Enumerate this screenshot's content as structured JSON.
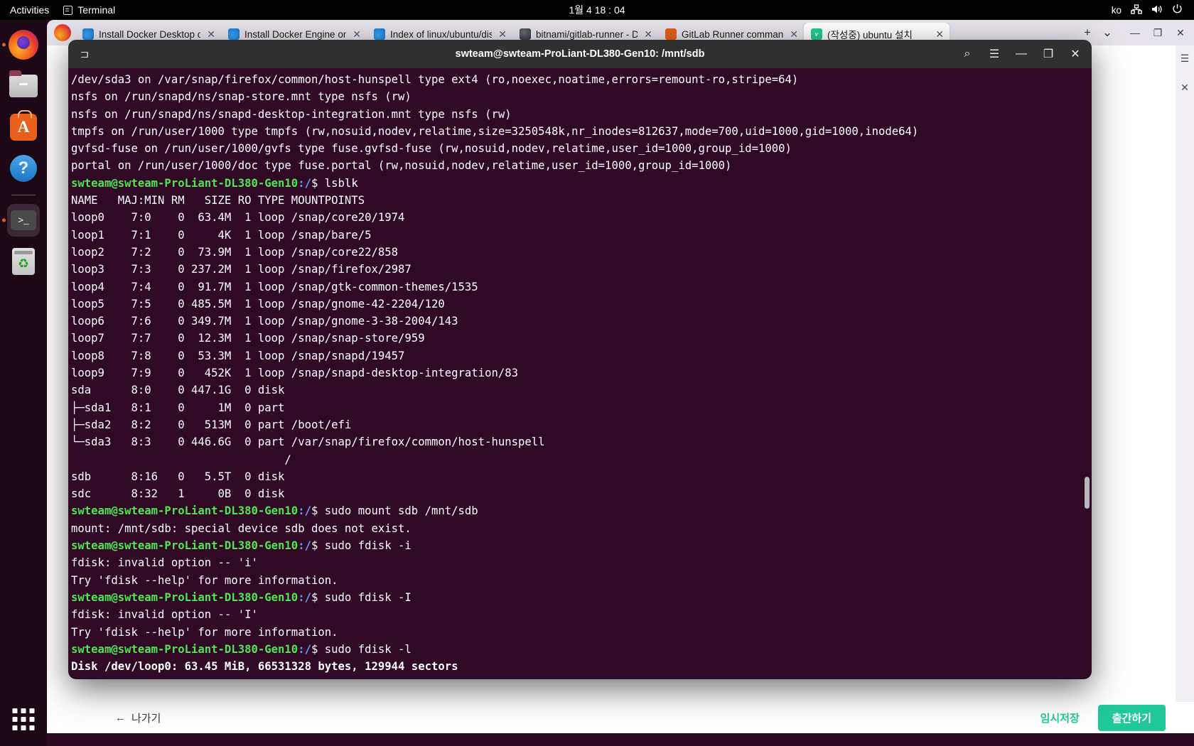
{
  "topbar": {
    "activities": "Activities",
    "app_name": "Terminal",
    "app_icon": "terminal-icon",
    "clock": "1월 4 18 : 04",
    "language": "ko",
    "icons": [
      "network-icon",
      "volume-icon",
      "power-icon"
    ]
  },
  "dock": {
    "items": [
      {
        "name": "firefox",
        "icon": "firefox-icon",
        "running": true
      },
      {
        "name": "files",
        "icon": "files-icon",
        "running": false
      },
      {
        "name": "app-center",
        "icon": "app-center-icon",
        "running": false
      },
      {
        "name": "help",
        "icon": "help-icon",
        "running": false
      },
      {
        "name": "terminal",
        "icon": "terminal-icon",
        "running": true,
        "active": true
      },
      {
        "name": "trash",
        "icon": "trash-icon",
        "running": false
      }
    ],
    "show_apps_label": "show-applications"
  },
  "browser": {
    "tabs": [
      {
        "label": "Install Docker Desktop o",
        "favicon": "firefox-docs-icon",
        "active": false
      },
      {
        "label": "Install Docker Engine on",
        "favicon": "firefox-docs-icon",
        "active": false
      },
      {
        "label": "Index of linux/ubuntu/dis",
        "favicon": "firefox-docs-icon",
        "active": false
      },
      {
        "label": "bitnami/gitlab-runner - D",
        "favicon": "globe-icon",
        "active": false
      },
      {
        "label": "GitLab Runner command",
        "favicon": "gitlab-icon",
        "active": false
      },
      {
        "label": "(작성중) ubuntu 설치",
        "favicon": "velog-icon",
        "active": true
      }
    ],
    "tab_close_label": "✕",
    "new_tab_label": "+",
    "list_all_tabs_label": "⌄",
    "window_controls": {
      "minimize": "—",
      "maximize": "❐",
      "close": "✕"
    }
  },
  "page_bottom": {
    "exit_label": "나가기",
    "exit_arrow": "←",
    "temp_save_label": "임시저장",
    "publish_label": "출간하기"
  },
  "terminal": {
    "title": "swteam@swteam-ProLiant-DL380-Gen10: /mnt/sdb",
    "header_icons": {
      "new_tab": "new-terminal-tab-icon",
      "search": "search-icon",
      "menu": "hamburger-menu-icon",
      "minimize": "—",
      "maximize": "❐",
      "close": "✕"
    },
    "prompt_user": "swteam@swteam-ProLiant-DL380-Gen10",
    "prompt_path": ":/",
    "prompt_sigil": "$ ",
    "lines": [
      {
        "type": "out",
        "text": "/dev/sda3 on /var/snap/firefox/common/host-hunspell type ext4 (ro,noexec,noatime,errors=remount-ro,stripe=64)"
      },
      {
        "type": "out",
        "text": "nsfs on /run/snapd/ns/snap-store.mnt type nsfs (rw)"
      },
      {
        "type": "out",
        "text": "nsfs on /run/snapd/ns/snapd-desktop-integration.mnt type nsfs (rw)"
      },
      {
        "type": "out",
        "text": "tmpfs on /run/user/1000 type tmpfs (rw,nosuid,nodev,relatime,size=3250548k,nr_inodes=812637,mode=700,uid=1000,gid=1000,inode64)"
      },
      {
        "type": "out",
        "text": "gvfsd-fuse on /run/user/1000/gvfs type fuse.gvfsd-fuse (rw,nosuid,nodev,relatime,user_id=1000,group_id=1000)"
      },
      {
        "type": "out",
        "text": "portal on /run/user/1000/doc type fuse.portal (rw,nosuid,nodev,relatime,user_id=1000,group_id=1000)"
      },
      {
        "type": "cmd",
        "text": "lsblk"
      },
      {
        "type": "out",
        "text": "NAME   MAJ:MIN RM   SIZE RO TYPE MOUNTPOINTS"
      },
      {
        "type": "out",
        "text": "loop0    7:0    0  63.4M  1 loop /snap/core20/1974"
      },
      {
        "type": "out",
        "text": "loop1    7:1    0     4K  1 loop /snap/bare/5"
      },
      {
        "type": "out",
        "text": "loop2    7:2    0  73.9M  1 loop /snap/core22/858"
      },
      {
        "type": "out",
        "text": "loop3    7:3    0 237.2M  1 loop /snap/firefox/2987"
      },
      {
        "type": "out",
        "text": "loop4    7:4    0  91.7M  1 loop /snap/gtk-common-themes/1535"
      },
      {
        "type": "out",
        "text": "loop5    7:5    0 485.5M  1 loop /snap/gnome-42-2204/120"
      },
      {
        "type": "out",
        "text": "loop6    7:6    0 349.7M  1 loop /snap/gnome-3-38-2004/143"
      },
      {
        "type": "out",
        "text": "loop7    7:7    0  12.3M  1 loop /snap/snap-store/959"
      },
      {
        "type": "out",
        "text": "loop8    7:8    0  53.3M  1 loop /snap/snapd/19457"
      },
      {
        "type": "out",
        "text": "loop9    7:9    0   452K  1 loop /snap/snapd-desktop-integration/83"
      },
      {
        "type": "out",
        "text": "sda      8:0    0 447.1G  0 disk"
      },
      {
        "type": "out",
        "text": "├─sda1   8:1    0     1M  0 part"
      },
      {
        "type": "out",
        "text": "├─sda2   8:2    0   513M  0 part /boot/efi"
      },
      {
        "type": "out",
        "text": "└─sda3   8:3    0 446.6G  0 part /var/snap/firefox/common/host-hunspell"
      },
      {
        "type": "out",
        "text": "                                /"
      },
      {
        "type": "out",
        "text": "sdb      8:16   0   5.5T  0 disk"
      },
      {
        "type": "out",
        "text": "sdc      8:32   1     0B  0 disk"
      },
      {
        "type": "cmd",
        "text": "sudo mount sdb /mnt/sdb"
      },
      {
        "type": "out",
        "text": "mount: /mnt/sdb: special device sdb does not exist."
      },
      {
        "type": "cmd",
        "text": "sudo fdisk -i"
      },
      {
        "type": "out",
        "text": "fdisk: invalid option -- 'i'"
      },
      {
        "type": "out",
        "text": "Try 'fdisk --help' for more information."
      },
      {
        "type": "cmd",
        "text": "sudo fdisk -I"
      },
      {
        "type": "out",
        "text": "fdisk: invalid option -- 'I'"
      },
      {
        "type": "out",
        "text": "Try 'fdisk --help' for more information."
      },
      {
        "type": "cmd",
        "text": "sudo fdisk -l"
      },
      {
        "type": "bold",
        "text": "Disk /dev/loop0: 63.45 MiB, 66531328 bytes, 129944 sectors"
      }
    ]
  },
  "colors": {
    "terminal_bg": "#300a24",
    "terminal_header": "#303030",
    "prompt_green": "#4fe64f",
    "prompt_blue": "#6b9bfa",
    "accent_teal": "#20c997",
    "ubuntu_orange": "#e8601c"
  }
}
